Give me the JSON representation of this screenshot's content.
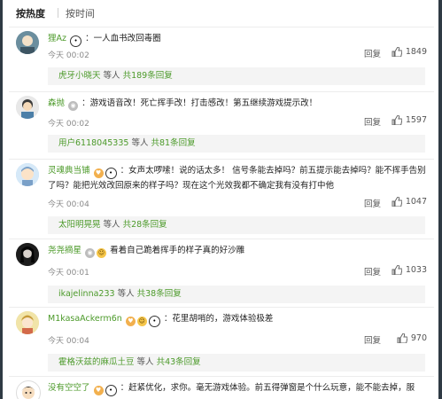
{
  "sort": {
    "hot_label": "按热度",
    "time_label": "按时间"
  },
  "comments": [
    {
      "user": "狸Az",
      "text": "：一人血书改回毒圈",
      "time": "今天 00:02",
      "reply_label": "回复",
      "likes": "1849",
      "sub": {
        "user": "虎牙小晓天",
        "middle": " 等人 ",
        "count": "共189条回复"
      }
    },
    {
      "user": "森抛",
      "text": "：游戏语音改！死亡挥手改！打击感改！第五继续游戏提示改！",
      "time": "今天 00:02",
      "reply_label": "回复",
      "likes": "1597",
      "sub": {
        "user": "用户6118045335",
        "middle": " 等人 ",
        "count": "共81条回复"
      }
    },
    {
      "user": "灵魂典当铺",
      "text": "：女声太啰嗦！说的话太多！ 信号条能去掉吗？前五提示能去掉吗？能不挥手告别了吗？能把光效改回原来的样子吗？现在这个光效我都不确定我有没有打中他",
      "time": "今天 00:04",
      "reply_label": "回复",
      "likes": "1047",
      "sub": {
        "user": "太阳明晃晃",
        "middle": " 等人 ",
        "count": "共28条回复"
      }
    },
    {
      "user": "尧尧摘星",
      "text": "看着自己跪着挥手的样子真的好沙雕",
      "time": "今天 00:01",
      "reply_label": "回复",
      "likes": "1033",
      "sub": {
        "user": "ikajelinna233",
        "middle": " 等人 ",
        "count": "共38条回复"
      }
    },
    {
      "user": "M1kasaAckerm6n",
      "text": "：花里胡哨的，游戏体验极差",
      "time": "今天 00:04",
      "reply_label": "回复",
      "likes": "970",
      "sub": {
        "user": "霍格沃兹的麻瓜土豆",
        "middle": " 等人 ",
        "count": "共43条回复"
      }
    },
    {
      "user": "没有空空了",
      "text": "：赶紧优化，求你。毫无游戏体验。前五得弹窗是个什么玩意，能不能去掉，服",
      "time": "",
      "reply_label": "",
      "likes": "",
      "sub": null
    }
  ],
  "icons": {
    "badge_panda": "panda-badge-icon",
    "badge_level": "level-badge-icon",
    "badge_fan": "fan-badge-icon",
    "like": "thumbs-up-icon"
  },
  "colors": {
    "username": "#4c9a2a",
    "meta": "#8a8a8a",
    "sub_bg": "#f4f4f4"
  }
}
